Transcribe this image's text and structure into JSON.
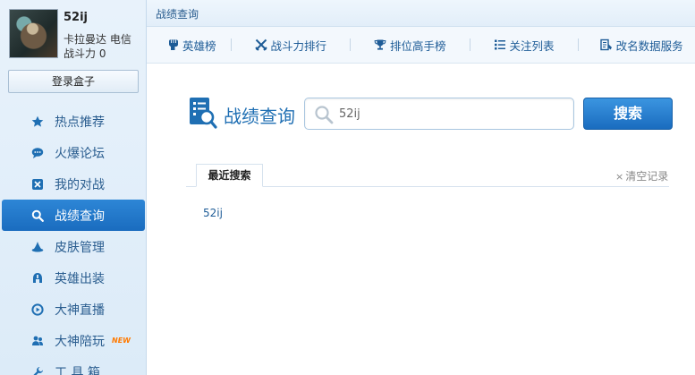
{
  "profile": {
    "name": "52ij",
    "server": "卡拉曼达 电信",
    "power": "战斗力 0",
    "login_label": "登录盒子"
  },
  "nav": {
    "items": [
      {
        "label": "热点推荐",
        "icon": "star-icon"
      },
      {
        "label": "火爆论坛",
        "icon": "chat-bubble-icon"
      },
      {
        "label": "我的对战",
        "icon": "battle-card-icon"
      },
      {
        "label": "战绩查询",
        "icon": "search-icon",
        "active": true
      },
      {
        "label": "皮肤管理",
        "icon": "wizard-hat-icon"
      },
      {
        "label": "英雄出装",
        "icon": "helmet-icon"
      },
      {
        "label": "大神直播",
        "icon": "play-circle-icon"
      },
      {
        "label": "大神陪玩",
        "icon": "users-icon",
        "badge": "NEW"
      },
      {
        "label": "工 具 箱",
        "icon": "wrench-icon"
      }
    ]
  },
  "topbar": {
    "title": "战绩查询"
  },
  "toolbar": {
    "items": [
      {
        "label": "英雄榜",
        "icon": "fist-icon"
      },
      {
        "label": "战斗力排行",
        "icon": "crossed-swords-icon"
      },
      {
        "label": "排位高手榜",
        "icon": "trophy-icon"
      },
      {
        "label": "关注列表",
        "icon": "list-icon"
      },
      {
        "label": "改名数据服务",
        "icon": "rename-icon"
      }
    ]
  },
  "search": {
    "title": "战绩查询",
    "value": "52ij",
    "button_label": "搜索"
  },
  "recent": {
    "tab_label": "最近搜索",
    "clear_label": "清空记录",
    "items": [
      "52ij"
    ]
  },
  "colors": {
    "accent": "#1f6fb3",
    "active_nav": "#2277c9",
    "button": "#1a6cbf"
  }
}
